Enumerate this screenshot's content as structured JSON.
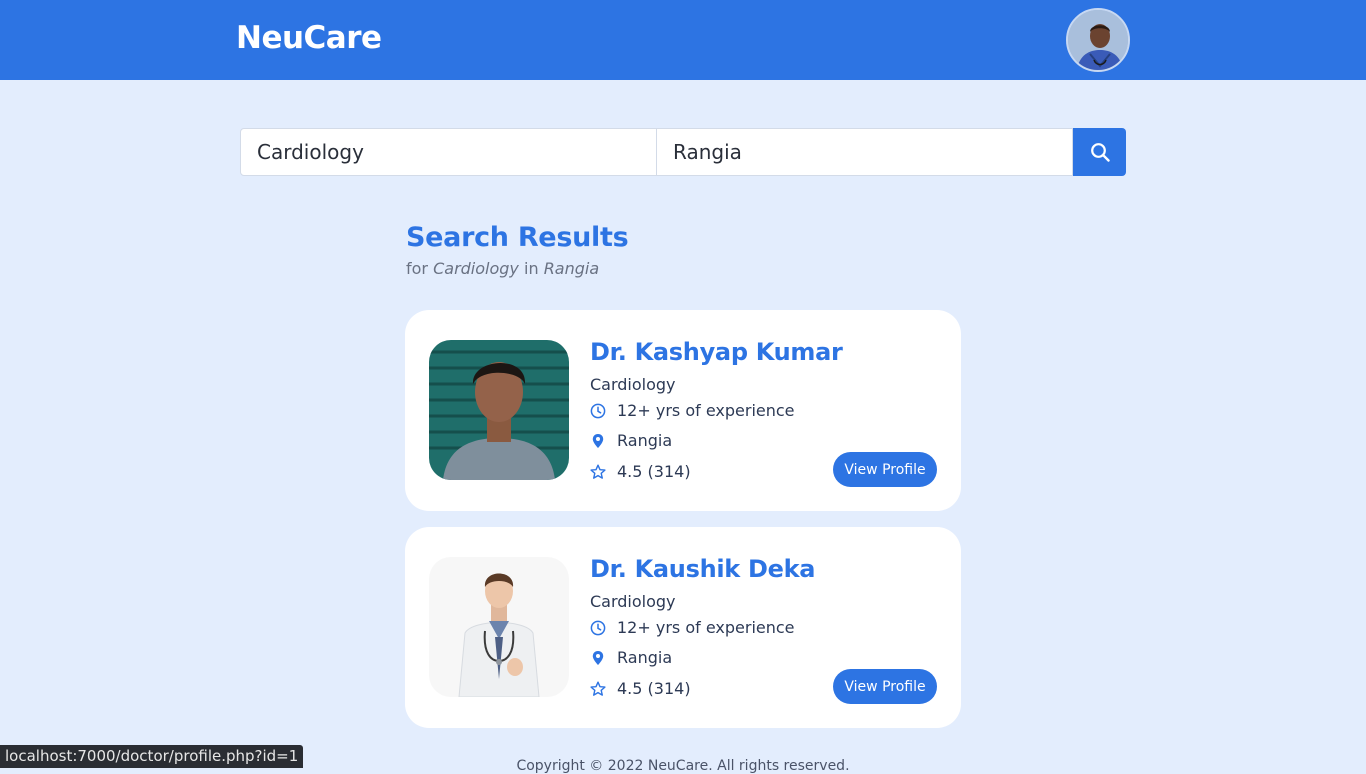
{
  "header": {
    "brand": "NeuCare",
    "avatar_icon": "doctor-avatar-icon"
  },
  "search": {
    "speciality_value": "Cardiology",
    "location_value": "Rangia",
    "button_icon": "search-icon"
  },
  "results": {
    "title": "Search Results",
    "subtitle_prefix": "for",
    "subtitle_speciality": "Cardiology",
    "subtitle_in": "in",
    "subtitle_location": "Rangia"
  },
  "doctors": [
    {
      "name": "Dr. Kashyap Kumar",
      "speciality": "Cardiology",
      "experience": "12+ yrs of experience",
      "location": "Rangia",
      "rating": "4.5 (314)",
      "button": "View Profile"
    },
    {
      "name": "Dr. Kaushik Deka",
      "speciality": "Cardiology",
      "experience": "12+ yrs of experience",
      "location": "Rangia",
      "rating": "4.5 (314)",
      "button": "View Profile"
    }
  ],
  "footer": {
    "text": "Copyright © 2022 NeuCare. All rights reserved."
  },
  "status_bar": {
    "url": "localhost:7000/doctor/profile.php?id=1"
  },
  "colors": {
    "primary": "#2d74e3",
    "background": "#e3edfd",
    "card": "#ffffff"
  }
}
